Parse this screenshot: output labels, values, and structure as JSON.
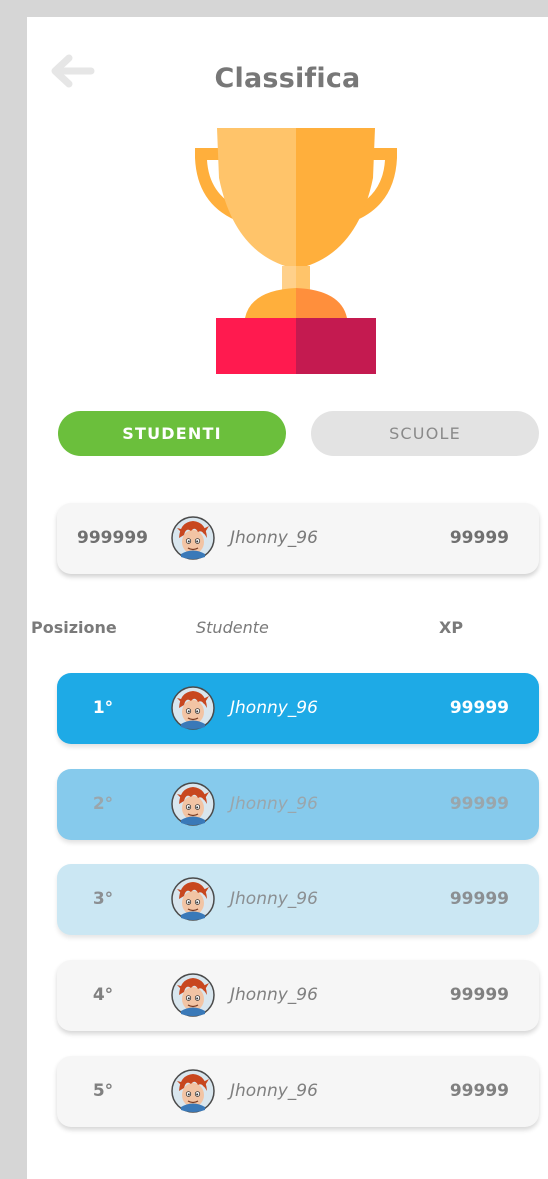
{
  "header": {
    "title": "Classifica",
    "back_icon": "arrow-left-icon"
  },
  "trophy_icon": "trophy-icon",
  "tabs": [
    {
      "label": "STUDENTI",
      "active": true
    },
    {
      "label": "SCUOLE",
      "active": false
    }
  ],
  "my_rank": {
    "position": "999999",
    "name": "Jhonny_96",
    "xp": "99999"
  },
  "columns": {
    "position": "Posizione",
    "student": "Studente",
    "xp": "XP"
  },
  "leaderboard": [
    {
      "position": "1°",
      "name": "Jhonny_96",
      "xp": "99999"
    },
    {
      "position": "2°",
      "name": "Jhonny_96",
      "xp": "99999"
    },
    {
      "position": "3°",
      "name": "Jhonny_96",
      "xp": "99999"
    },
    {
      "position": "4°",
      "name": "Jhonny_96",
      "xp": "99999"
    },
    {
      "position": "5°",
      "name": "Jhonny_96",
      "xp": "99999"
    }
  ],
  "colors": {
    "accent_green": "#6bbf3c",
    "rank1": "#1eaae6",
    "rank2": "#86caec",
    "rank3": "#cbe7f3",
    "row_default": "#f6f6f6"
  }
}
